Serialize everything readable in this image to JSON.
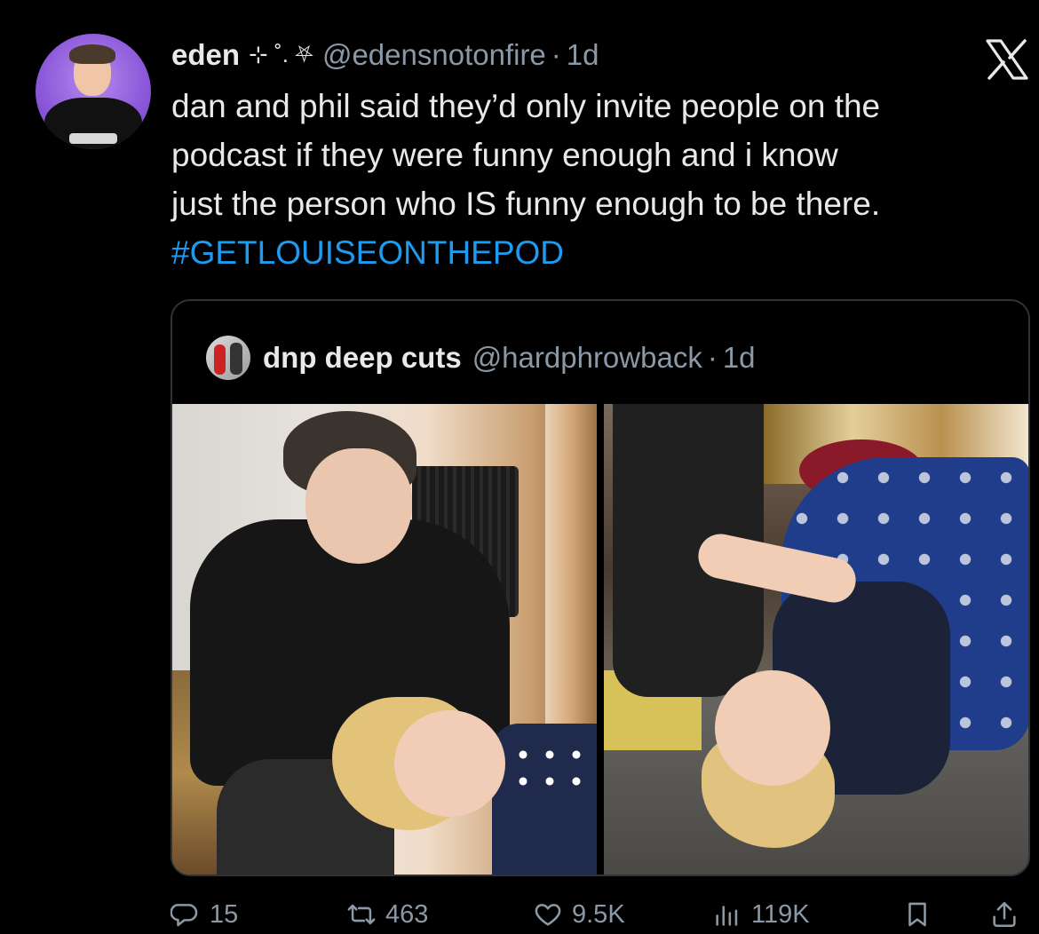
{
  "tweet": {
    "author_name": "eden",
    "author_decoration": "⊹ ˚. ⛧",
    "author_handle": "@edensnotonfire",
    "separator": "·",
    "time": "1d",
    "text_lines": [
      "dan and phil said they’d only invite people on the",
      "podcast if they were funny enough and i know",
      "just the person who IS funny enough to be there."
    ],
    "hashtag": "#GETLOUISEONTHEPOD"
  },
  "quote": {
    "author_name": "dnp deep cuts",
    "author_handle": "@hardphrowback",
    "separator": "·",
    "time": "1d"
  },
  "actions": {
    "replies": "15",
    "retweets": "463",
    "likes": "9.5K",
    "views": "119K"
  },
  "icons": {
    "brand": "x-logo-icon",
    "reply": "reply-icon",
    "retweet": "retweet-icon",
    "like": "heart-icon",
    "views": "views-icon",
    "bookmark": "bookmark-icon",
    "share": "share-icon"
  },
  "colors": {
    "background": "#000000",
    "text": "#e7e9ea",
    "muted": "#8b98a5",
    "link": "#1d9bf0",
    "border": "#2f3336"
  }
}
